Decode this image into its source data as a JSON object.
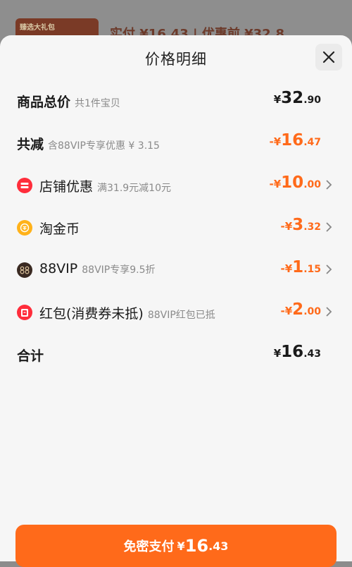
{
  "background": {
    "thumb_text": "臻选大礼包",
    "price_text": "实付 ¥16.43 | 优惠前 ¥32.8"
  },
  "sheet": {
    "title": "价格明细",
    "close_icon": "close-icon"
  },
  "rows": {
    "total": {
      "label": "商品总价",
      "sub": "共1件宝贝",
      "sym": "¥",
      "int": "32",
      "dec": ".90"
    },
    "reduced": {
      "label": "共减",
      "sub": "含88VIP专享优惠 ¥ 3.15",
      "sym": "-¥",
      "int": "16",
      "dec": ".47"
    },
    "shop": {
      "label": "店铺优惠",
      "sub": "满31.9元减10元",
      "sym": "-¥",
      "int": "10",
      "dec": ".00",
      "icon": "shop-coupon-icon"
    },
    "coins": {
      "label": "淘金币",
      "sub": "",
      "sym": "-¥",
      "int": "3",
      "dec": ".32",
      "icon": "coin-icon"
    },
    "vip": {
      "label": "88VIP",
      "sub": "88VIP专享9.5折",
      "sym": "-¥",
      "int": "1",
      "dec": ".15",
      "icon": "vip-88-icon"
    },
    "redpacket": {
      "label": "红包(消费券未抵)",
      "sub": "88VIP红包已抵",
      "sym": "-¥",
      "int": "2",
      "dec": ".00",
      "icon": "red-packet-icon"
    },
    "sum": {
      "label": "合计",
      "sym": "¥",
      "int": "16",
      "dec": ".43"
    }
  },
  "pay_button": {
    "label": "免密支付",
    "sym": "¥",
    "int": "16",
    "dec": ".43"
  },
  "colors": {
    "accent": "#ff6a1a",
    "text": "#1a1a1a",
    "muted": "#8a8a8a",
    "sheet_bg": "#f6f6f6"
  }
}
